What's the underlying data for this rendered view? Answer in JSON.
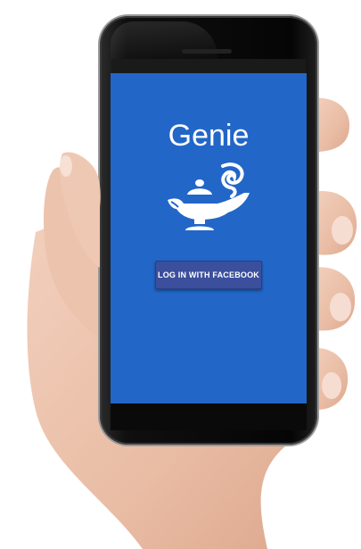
{
  "app": {
    "title": "Genie",
    "logo_icon": "magic-lamp-icon",
    "login_button_label": "LOG IN WITH FACEBOOK"
  },
  "colors": {
    "screen_background": "#2266c8",
    "facebook_button": "#3b4f9d",
    "text": "#ffffff"
  }
}
